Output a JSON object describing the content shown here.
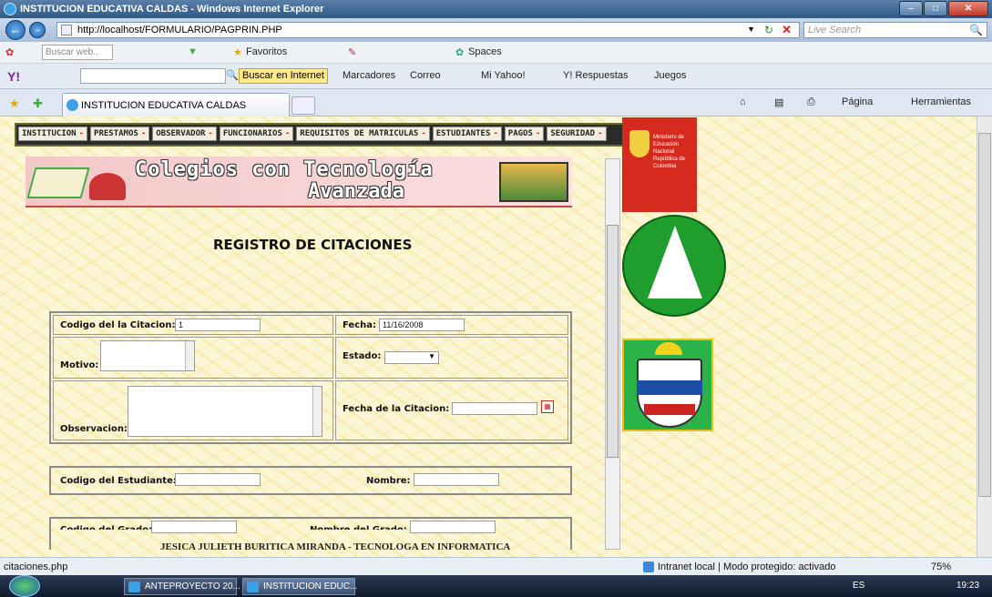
{
  "window": {
    "title": "INSTITUCION EDUCATIVA CALDAS - Windows Internet Explorer"
  },
  "address": {
    "url": "http://localhost/FORMULARIO/PAGPRIN.PHP",
    "search_placeholder": "Live Search"
  },
  "toolbar1": {
    "buscar_web": "Buscar web..",
    "favoritos": "Favoritos",
    "spaces": "Spaces"
  },
  "toolbar2": {
    "buscar_internet": "Buscar en Internet",
    "marcadores": "Marcadores",
    "correo": "Correo",
    "mi_yahoo": "Mi Yahoo!",
    "respuestas": "Y! Respuestas",
    "juegos": "Juegos"
  },
  "tab": {
    "title": "INSTITUCION EDUCATIVA CALDAS"
  },
  "commandbar": {
    "pagina": "Página",
    "herramientas": "Herramientas"
  },
  "menu": {
    "items": [
      "INSTITUCION",
      "PRESTAMOS",
      "OBSERVADOR",
      "FUNCIONARIOS",
      "REQUISITOS DE MATRICULAS",
      "ESTUDIANTES",
      "PAGOS",
      "SEGURIDAD"
    ]
  },
  "banner": {
    "title": "Colegios con Tecnología",
    "subtitle": "Avanzada"
  },
  "form": {
    "title": "REGISTRO DE CITACIONES",
    "codigo_label": "Codigo del la Citacion:",
    "codigo_value": "1",
    "fecha_label": "Fecha:",
    "fecha_value": "11/16/2008",
    "motivo_label": "Motivo:",
    "estado_label": "Estado:",
    "observacion_label": "Observacion:",
    "fecha_citacion_label": "Fecha de la Citacion:",
    "codigo_estudiante_label": "Codigo del Estudiante:",
    "nombre_label": "Nombre:",
    "codigo_grado_label": "Codigo del Grado:",
    "nombre_grado_label": "Nombre del Grado:"
  },
  "footer": {
    "credit": "JESICA JULIETH BURITICA MIRANDA - TECNOLOGA EN INFORMATICA"
  },
  "logos": {
    "ministerio": "Ministerio de Educación Nacional República de Colombia"
  },
  "status": {
    "left": "citaciones.php",
    "zone": "Intranet local | Modo protegido: activado",
    "zoom": "75%"
  },
  "taskbar": {
    "btn1": "ANTEPROYECTO 20...",
    "btn2": "INSTITUCION EDUC...",
    "lang": "ES",
    "time": "19:23"
  }
}
